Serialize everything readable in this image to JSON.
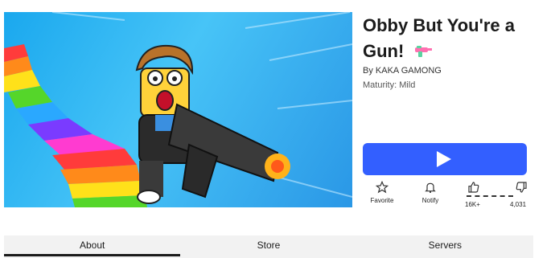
{
  "game": {
    "title": "Obby But You're a Gun!",
    "byline_prefix": "By",
    "creator": "KAKA GAMONG",
    "maturity_label": "Maturity:",
    "maturity_value": "Mild"
  },
  "actions": {
    "favorite": "Favorite",
    "notify": "Notify",
    "upvotes": "16K+",
    "downvotes": "4,031"
  },
  "tabs": [
    {
      "label": "About",
      "active": true
    },
    {
      "label": "Store",
      "active": false
    },
    {
      "label": "Servers",
      "active": false
    }
  ],
  "colors": {
    "play_button": "#335fff",
    "tab_bar": "#f2f2f2"
  },
  "icons": {
    "play": "play-icon",
    "favorite": "star-icon",
    "notify": "bell-icon",
    "upvote": "thumbs-up-icon",
    "downvote": "thumbs-down-icon",
    "title_emoji": "water-gun-icon"
  }
}
